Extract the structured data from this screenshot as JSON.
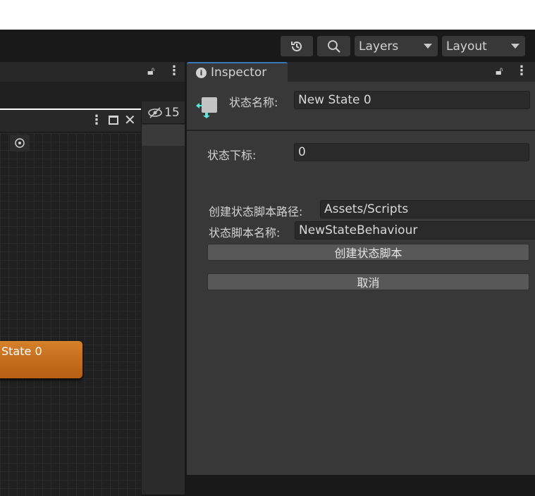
{
  "toolbar": {
    "history_icon": "history-icon",
    "search_icon": "search-icon",
    "layers_label": "Layers",
    "layout_label": "Layout"
  },
  "left_panel": {
    "hidden_count": "15",
    "state_node_label": "State 0"
  },
  "inspector": {
    "tab_label": "Inspector",
    "state_name_label": "状态名称:",
    "state_name_value": "New State 0",
    "state_index_label": "状态下标:",
    "state_index_value": "0",
    "script_path_label": "创建状态脚本路径:",
    "script_path_value": "Assets/Scripts",
    "script_name_label": "状态脚本名称:",
    "script_name_value": "NewStateBehaviour",
    "create_button": "创建状态脚本",
    "cancel_button": "取消"
  },
  "colors": {
    "accent": "#3a79bb",
    "state_node": "#c86f1e",
    "icon_cyan": "#5ee6d6"
  }
}
